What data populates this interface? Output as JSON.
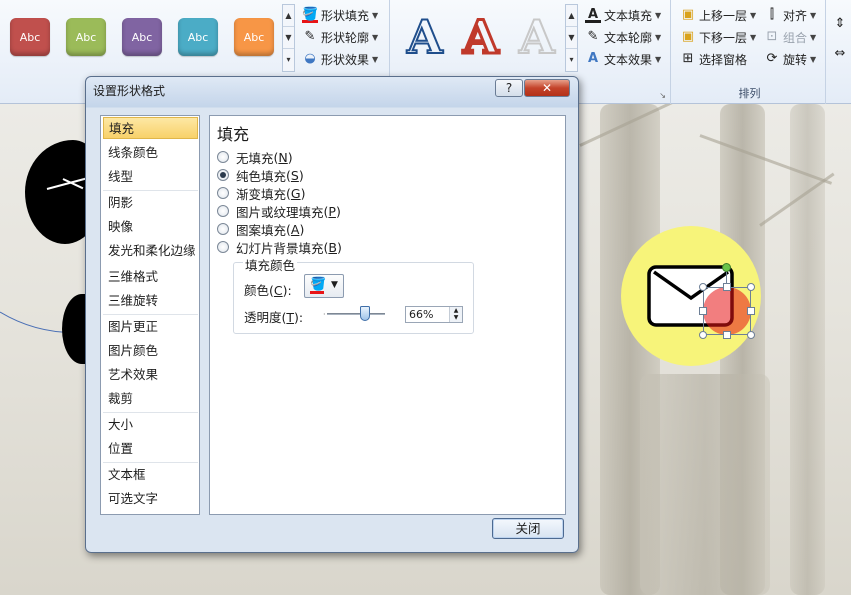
{
  "ribbon": {
    "style_swatches": [
      {
        "label": "Abc",
        "color": "#c0504d"
      },
      {
        "label": "Abc",
        "color": "#9bbb59"
      },
      {
        "label": "Abc",
        "color": "#8064a2"
      },
      {
        "label": "Abc",
        "color": "#4bacc6"
      },
      {
        "label": "Abc",
        "color": "#f79646"
      }
    ],
    "shape_fill": "形状填充",
    "shape_outline": "形状轮廓",
    "shape_effects": "形状效果",
    "wordart_letter": "A",
    "text_fill": "文本填充",
    "text_outline": "文本轮廓",
    "text_effects": "文本效果",
    "bring_forward": "上移一层",
    "send_backward": "下移一层",
    "selection_pane": "选择窗格",
    "align": "对齐",
    "group": "组合",
    "rotate": "旋转",
    "arrange_label": "排列"
  },
  "dialog": {
    "title": "设置形状格式",
    "help_glyph": "?",
    "close_glyph": "✕",
    "nav_items": [
      "填充",
      "线条颜色",
      "线型",
      "阴影",
      "映像",
      "发光和柔化边缘",
      "三维格式",
      "三维旋转",
      "图片更正",
      "图片颜色",
      "艺术效果",
      "裁剪",
      "大小",
      "位置",
      "文本框",
      "可选文字"
    ],
    "nav_selected": "填充",
    "panel_title": "填充",
    "options": [
      {
        "label": "无填充",
        "key": "N",
        "selected": false
      },
      {
        "label": "纯色填充",
        "key": "S",
        "selected": true
      },
      {
        "label": "渐变填充",
        "key": "G",
        "selected": false
      },
      {
        "label": "图片或纹理填充",
        "key": "P",
        "selected": false
      },
      {
        "label": "图案填充",
        "key": "A",
        "selected": false
      },
      {
        "label": "幻灯片背景填充",
        "key": "B",
        "selected": false
      }
    ],
    "fill_color_group": "填充颜色",
    "color_label": "颜色",
    "color_key": "C",
    "transparency_label": "透明度",
    "transparency_key": "T",
    "transparency_value": "66%",
    "transparency_fraction": 0.66,
    "fill_color": "#e81416",
    "close_button": "关闭"
  }
}
